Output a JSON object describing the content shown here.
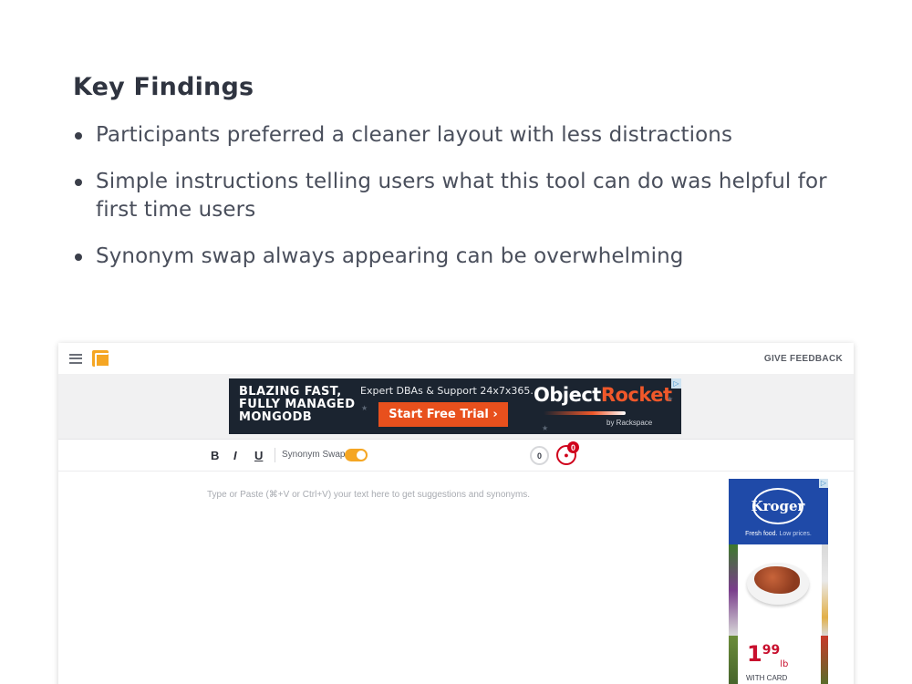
{
  "findings": {
    "title": "Key Findings",
    "items": [
      "Participants preferred a cleaner layout with less distractions",
      "Simple instructions telling users what this tool can do was helpful for first time users",
      "Synonym swap always appearing can be overwhelming"
    ]
  },
  "app": {
    "header": {
      "menu_icon": "hamburger-menu-icon",
      "logo_icon": "app-logo-icon",
      "feedback_label": "GIVE FEEDBACK"
    },
    "banner_ad": {
      "headline": "BLAZING FAST,\nFULLY MANAGED\nMONGODB",
      "subtext": "Expert DBAs & Support 24x7x365.",
      "cta_label": "Start Free Trial  ›",
      "brand_main": "Object",
      "brand_accent": "Rocket",
      "brand_by": "by Rackspace",
      "adchoices": "▷",
      "colors": {
        "background": "#1b2430",
        "cta": "#e8501d"
      }
    },
    "toolbar": {
      "bold_label": "B",
      "italic_label": "I",
      "underline_label": "U",
      "synonym_swap_label": "Synonym Swap",
      "synonym_swap_on": true,
      "count_a": "0",
      "count_b": "0",
      "accent_color": "#f5a623",
      "alert_color": "#d0021b"
    },
    "editor": {
      "placeholder": "Type or Paste (⌘+V or Ctrl+V) your text here to get suggestions and synonyms."
    },
    "side_ad": {
      "brand": "Kroger",
      "tagline_strong": "Fresh food.",
      "tagline_light": " Low prices.",
      "price_dollars": "1",
      "price_cents": "99",
      "price_unit": "lb",
      "price_note": "WITH CARD",
      "adchoices": "▷"
    }
  }
}
